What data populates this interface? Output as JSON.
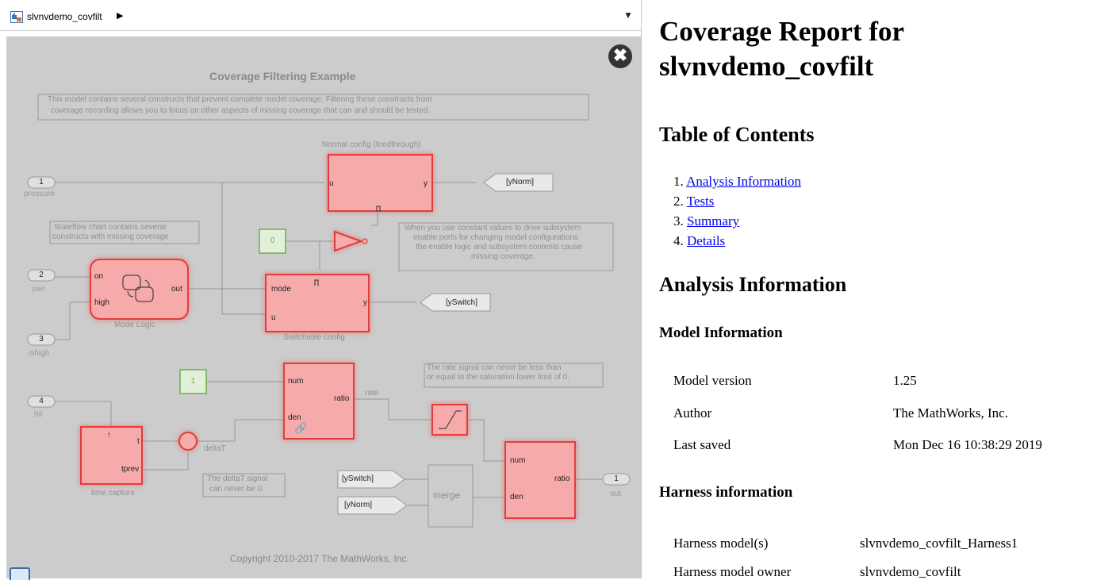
{
  "editor": {
    "breadcrumb": "slvnvdemo_covfilt",
    "diagram": {
      "title": "Coverage Filtering Example",
      "intro_line1": "This model contains several constructs that prevent complete model coverage. Filtering these constructs from",
      "intro_line2": "coverage recording allows you to focus on other aspects of missing coverage that can and should be tested.",
      "normal_config_label": "Normal config (feedthrough)",
      "inport1_num": "1",
      "inport1_name": "pressure",
      "inport2_num": "2",
      "inport2_name": "pwr",
      "inport3_num": "3",
      "inport3_name": "ishigh",
      "inport4_num": "4",
      "inport4_name": "hit",
      "goto_ynorm": "[yNorm]",
      "goto_yswitch": "[ySwitch]",
      "from_yswitch": "[ySwitch]",
      "from_ynorm": "[yNorm]",
      "note_stateflow_line1": "Stateflow chart contains several",
      "note_stateflow_line2": "constructs with missing coverage",
      "const0": "0",
      "const1": "1",
      "note_enable_line1": "When you use constant values to drive subsystem",
      "note_enable_line2": "enable ports for changing model configurations",
      "note_enable_line3": "the enable logic and subsystem contents cause",
      "note_enable_line4": "missing coverage.",
      "port_u": "u",
      "port_y": "y",
      "port_on": "on",
      "port_high": "high",
      "port_out": "out",
      "port_mode": "mode",
      "port_u2": "u",
      "port_y2": "y",
      "mode_logic_label": "Mode Logic",
      "switchable_label": "Switchable config",
      "note_rate_line1": "The rate signal can never be less than",
      "note_rate_line2": "or equal to the saturation lower limit of 0.",
      "port_num": "num",
      "port_den": "den",
      "port_ratio": "ratio",
      "rate_label": "rate",
      "deltat_label": "deltaT",
      "port_t": "t",
      "port_tprev": "tprev",
      "time_capture_label": "time capture",
      "note_deltat_line1": "The deltaT signal",
      "note_deltat_line2": "can never be 0.",
      "merge_label": "merge",
      "port_num2": "num",
      "port_den2": "den",
      "port_ratio2": "ratio",
      "outport_num": "1",
      "outport_name": "out",
      "copyright": "Copyright 2010-2017 The MathWorks, Inc."
    }
  },
  "report": {
    "title": "Coverage Report for slvnvdemo_covfilt",
    "toc_heading": "Table of Contents",
    "toc": [
      {
        "num": "1.",
        "label": "Analysis Information"
      },
      {
        "num": "2.",
        "label": "Tests"
      },
      {
        "num": "3.",
        "label": "Summary"
      },
      {
        "num": "4.",
        "label": "Details"
      }
    ],
    "analysis_heading": "Analysis Information",
    "model_info_heading": "Model Information",
    "model_info": [
      {
        "key": "Model version",
        "value": "1.25"
      },
      {
        "key": "Author",
        "value": "The MathWorks, Inc."
      },
      {
        "key": "Last saved",
        "value": "Mon Dec 16 10:38:29 2019"
      }
    ],
    "harness_heading": "Harness information",
    "harness_info": [
      {
        "key": "Harness model(s)",
        "value": "slvnvdemo_covfilt_Harness1"
      },
      {
        "key": "Harness model owner",
        "value": "slvnvdemo_covfilt"
      }
    ]
  },
  "colors": {
    "canvas": "#cccccc",
    "block_fill": "#f7aaaa",
    "block_glow": "#e05050",
    "link": "#0000ee"
  }
}
